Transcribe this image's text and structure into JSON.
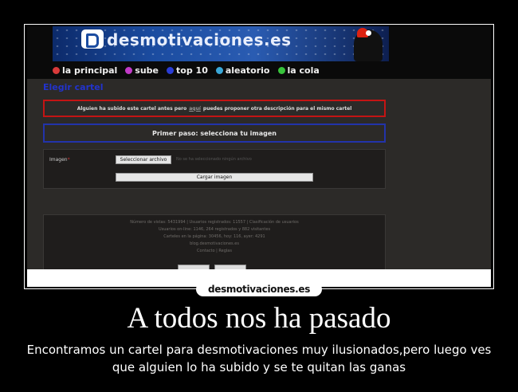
{
  "site": {
    "logo_text": "desmotivaciones.es",
    "nav": [
      {
        "label": "la principal",
        "icon": "home-icon",
        "color": "#d93a3a"
      },
      {
        "label": "sube",
        "icon": "upload-icon",
        "color": "#c23ac9"
      },
      {
        "label": "top 10",
        "icon": "star-icon",
        "color": "#2a3dd6"
      },
      {
        "label": "aleatorio",
        "icon": "shuffle-icon",
        "color": "#3aa8d9"
      },
      {
        "label": "la cola",
        "icon": "queue-icon",
        "color": "#38c43c"
      }
    ]
  },
  "page": {
    "title": "Elegir cartel",
    "notice": {
      "before": "Alguien ha subido este cartel antes pero",
      "link": "aquí",
      "after": "puedes proponer otra descripción para el mismo cartel"
    },
    "step": "Primer paso: selecciona tu imagen",
    "upload": {
      "label": "Imagen",
      "required_mark": "*",
      "file_button": "Seleccionar archivo",
      "file_status": "No se ha seleccionado ningún archivo",
      "submit_button": "Cargar imagen"
    },
    "footer_lines": [
      "Número de vistas: 5431994 | Usuarios registrados: 11557 | Clasificación de usuarios",
      "Usuarios on-line: 1146, 264 registrados y 882 visitantes",
      "Carteles en la página: 30456, hoy: 116, ayer: 4291",
      "blog.desmotivaciones.es",
      "Contacto | Reglas"
    ]
  },
  "poster": {
    "watermark": "desmotivaciones.es",
    "title": "A todos nos ha pasado",
    "caption": "Encontramos un cartel para desmotivaciones muy ilusionados,pero luego ves que alguien lo ha subido y se te quitan las ganas"
  },
  "colors": {
    "notice_border": "#c41414",
    "step_border": "#2233aa",
    "title_color": "#2233cc"
  }
}
